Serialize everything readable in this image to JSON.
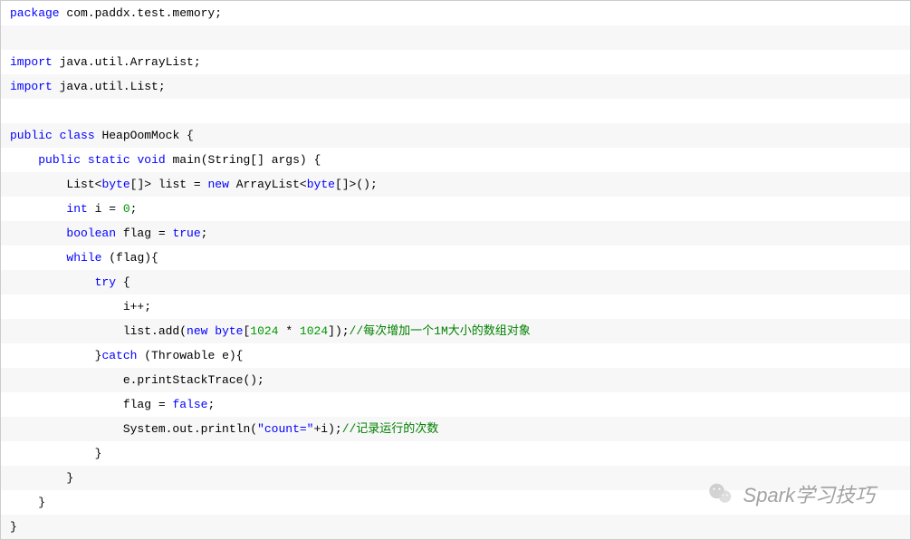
{
  "code": {
    "lines": [
      {
        "indent": 0,
        "parts": [
          {
            "t": "package",
            "c": "keyword"
          },
          {
            "t": " com.paddx.test.memory;",
            "c": "plain"
          }
        ]
      },
      {
        "indent": 0,
        "parts": []
      },
      {
        "indent": 0,
        "parts": [
          {
            "t": "import",
            "c": "keyword"
          },
          {
            "t": " java.util.ArrayList;",
            "c": "plain"
          }
        ]
      },
      {
        "indent": 0,
        "parts": [
          {
            "t": "import",
            "c": "keyword"
          },
          {
            "t": " java.util.List;",
            "c": "plain"
          }
        ]
      },
      {
        "indent": 0,
        "parts": []
      },
      {
        "indent": 0,
        "parts": [
          {
            "t": "public",
            "c": "keyword"
          },
          {
            "t": " ",
            "c": "plain"
          },
          {
            "t": "class",
            "c": "keyword"
          },
          {
            "t": " HeapOomMock {",
            "c": "plain"
          }
        ]
      },
      {
        "indent": 1,
        "parts": [
          {
            "t": "public",
            "c": "keyword"
          },
          {
            "t": " ",
            "c": "plain"
          },
          {
            "t": "static",
            "c": "keyword"
          },
          {
            "t": " ",
            "c": "plain"
          },
          {
            "t": "void",
            "c": "keyword"
          },
          {
            "t": " main(String[] args) {",
            "c": "plain"
          }
        ]
      },
      {
        "indent": 2,
        "parts": [
          {
            "t": "List<",
            "c": "plain"
          },
          {
            "t": "byte",
            "c": "keyword"
          },
          {
            "t": "[]> list = ",
            "c": "plain"
          },
          {
            "t": "new",
            "c": "keyword"
          },
          {
            "t": " ArrayList<",
            "c": "plain"
          },
          {
            "t": "byte",
            "c": "keyword"
          },
          {
            "t": "[]>();",
            "c": "plain"
          }
        ]
      },
      {
        "indent": 2,
        "parts": [
          {
            "t": "int",
            "c": "keyword"
          },
          {
            "t": " i = ",
            "c": "plain"
          },
          {
            "t": "0",
            "c": "number"
          },
          {
            "t": ";",
            "c": "plain"
          }
        ]
      },
      {
        "indent": 2,
        "parts": [
          {
            "t": "boolean",
            "c": "keyword"
          },
          {
            "t": " flag = ",
            "c": "plain"
          },
          {
            "t": "true",
            "c": "keyword"
          },
          {
            "t": ";",
            "c": "plain"
          }
        ]
      },
      {
        "indent": 2,
        "parts": [
          {
            "t": "while",
            "c": "keyword"
          },
          {
            "t": " (flag){",
            "c": "plain"
          }
        ]
      },
      {
        "indent": 3,
        "parts": [
          {
            "t": "try",
            "c": "keyword"
          },
          {
            "t": " {",
            "c": "plain"
          }
        ]
      },
      {
        "indent": 4,
        "parts": [
          {
            "t": "i++;",
            "c": "plain"
          }
        ]
      },
      {
        "indent": 4,
        "parts": [
          {
            "t": "list.add(",
            "c": "plain"
          },
          {
            "t": "new",
            "c": "keyword"
          },
          {
            "t": " ",
            "c": "plain"
          },
          {
            "t": "byte",
            "c": "keyword"
          },
          {
            "t": "[",
            "c": "plain"
          },
          {
            "t": "1024",
            "c": "number"
          },
          {
            "t": " * ",
            "c": "plain"
          },
          {
            "t": "1024",
            "c": "number"
          },
          {
            "t": "]);",
            "c": "plain"
          },
          {
            "t": "//每次增加一个1M大小的数组对象",
            "c": "comment"
          }
        ]
      },
      {
        "indent": 3,
        "parts": [
          {
            "t": "}",
            "c": "plain"
          },
          {
            "t": "catch",
            "c": "keyword"
          },
          {
            "t": " (Throwable e){",
            "c": "plain"
          }
        ]
      },
      {
        "indent": 4,
        "parts": [
          {
            "t": "e.printStackTrace();",
            "c": "plain"
          }
        ]
      },
      {
        "indent": 4,
        "parts": [
          {
            "t": "flag = ",
            "c": "plain"
          },
          {
            "t": "false",
            "c": "keyword"
          },
          {
            "t": ";",
            "c": "plain"
          }
        ]
      },
      {
        "indent": 4,
        "parts": [
          {
            "t": "System.out.println(",
            "c": "plain"
          },
          {
            "t": "\"count=\"",
            "c": "string"
          },
          {
            "t": "+i);",
            "c": "plain"
          },
          {
            "t": "//记录运行的次数",
            "c": "comment"
          }
        ]
      },
      {
        "indent": 3,
        "parts": [
          {
            "t": "}",
            "c": "plain"
          }
        ]
      },
      {
        "indent": 2,
        "parts": [
          {
            "t": "}",
            "c": "plain"
          }
        ]
      },
      {
        "indent": 1,
        "parts": [
          {
            "t": "}",
            "c": "plain"
          }
        ]
      },
      {
        "indent": 0,
        "parts": [
          {
            "t": "}",
            "c": "plain"
          }
        ]
      }
    ]
  },
  "watermark": {
    "text": "Spark学习技巧"
  },
  "indentUnit": "    "
}
